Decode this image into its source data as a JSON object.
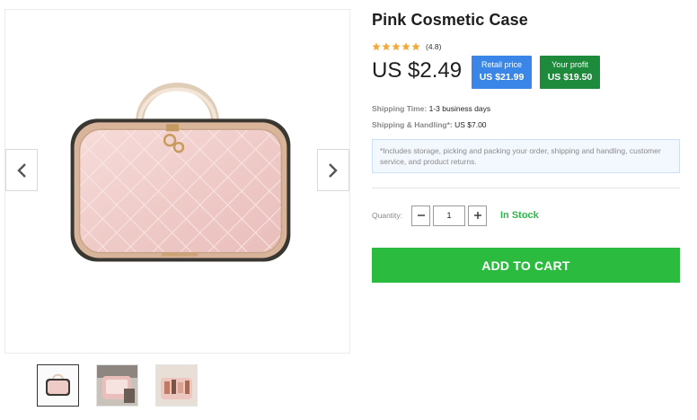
{
  "product": {
    "title": "Pink Cosmetic Case",
    "rating": {
      "stars": 5,
      "value_text": "(4.8)"
    },
    "price": "US $2.49",
    "retail": {
      "label": "Retail price",
      "value": "US $21.99"
    },
    "profit": {
      "label": "Your profit",
      "value": "US $19.50"
    },
    "shipping_time": {
      "label": "Shipping Time:",
      "value": "1-3 business days"
    },
    "shipping_handling": {
      "label": "Shipping & Handling*:",
      "value": "US $7.00"
    },
    "note": "*Includes storage, picking and packing your order, shipping and handling, customer service, and product returns.",
    "quantity": {
      "label": "Quantity:",
      "value": "1",
      "minus": "−",
      "plus": "+"
    },
    "stock_status": "In Stock",
    "add_to_cart": "ADD TO CART"
  },
  "gallery": {
    "thumbnails": [
      "main-view",
      "open-view",
      "interior-view"
    ],
    "prev_icon": "chevron-left-icon",
    "next_icon": "chevron-right-icon"
  },
  "colors": {
    "retail_badge": "#3a86e8",
    "profit_badge": "#1d8a3c",
    "add_to_cart": "#2bbc3f",
    "in_stock": "#2fb84a",
    "star": "#f4a93a"
  }
}
